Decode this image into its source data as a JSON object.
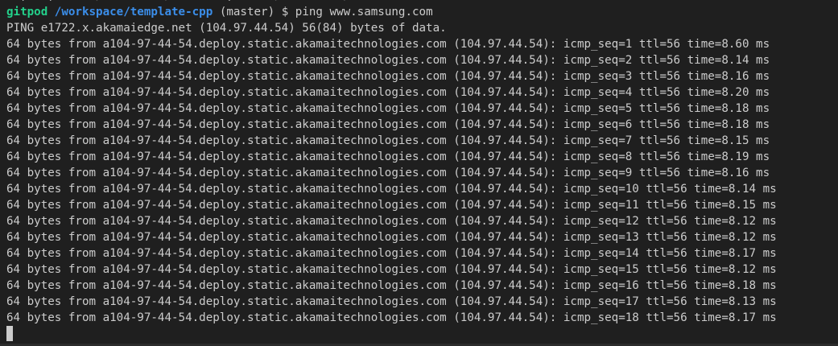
{
  "terminal": {
    "cut_line": "  ,   ,      /         /        ,      /         /",
    "prompt": {
      "user": "gitpod",
      "path": "/workspace/template-cpp",
      "branch": "(master)",
      "symbol": "$",
      "command": "ping www.samsung.com"
    },
    "header": "PING e1722.x.akamaiedge.net (104.97.44.54) 56(84) bytes of data.",
    "replies": [
      "64 bytes from a104-97-44-54.deploy.static.akamaitechnologies.com (104.97.44.54): icmp_seq=1 ttl=56 time=8.60 ms",
      "64 bytes from a104-97-44-54.deploy.static.akamaitechnologies.com (104.97.44.54): icmp_seq=2 ttl=56 time=8.14 ms",
      "64 bytes from a104-97-44-54.deploy.static.akamaitechnologies.com (104.97.44.54): icmp_seq=3 ttl=56 time=8.16 ms",
      "64 bytes from a104-97-44-54.deploy.static.akamaitechnologies.com (104.97.44.54): icmp_seq=4 ttl=56 time=8.20 ms",
      "64 bytes from a104-97-44-54.deploy.static.akamaitechnologies.com (104.97.44.54): icmp_seq=5 ttl=56 time=8.18 ms",
      "64 bytes from a104-97-44-54.deploy.static.akamaitechnologies.com (104.97.44.54): icmp_seq=6 ttl=56 time=8.18 ms",
      "64 bytes from a104-97-44-54.deploy.static.akamaitechnologies.com (104.97.44.54): icmp_seq=7 ttl=56 time=8.15 ms",
      "64 bytes from a104-97-44-54.deploy.static.akamaitechnologies.com (104.97.44.54): icmp_seq=8 ttl=56 time=8.19 ms",
      "64 bytes from a104-97-44-54.deploy.static.akamaitechnologies.com (104.97.44.54): icmp_seq=9 ttl=56 time=8.16 ms",
      "64 bytes from a104-97-44-54.deploy.static.akamaitechnologies.com (104.97.44.54): icmp_seq=10 ttl=56 time=8.14 ms",
      "64 bytes from a104-97-44-54.deploy.static.akamaitechnologies.com (104.97.44.54): icmp_seq=11 ttl=56 time=8.15 ms",
      "64 bytes from a104-97-44-54.deploy.static.akamaitechnologies.com (104.97.44.54): icmp_seq=12 ttl=56 time=8.12 ms",
      "64 bytes from a104-97-44-54.deploy.static.akamaitechnologies.com (104.97.44.54): icmp_seq=13 ttl=56 time=8.12 ms",
      "64 bytes from a104-97-44-54.deploy.static.akamaitechnologies.com (104.97.44.54): icmp_seq=14 ttl=56 time=8.17 ms",
      "64 bytes from a104-97-44-54.deploy.static.akamaitechnologies.com (104.97.44.54): icmp_seq=15 ttl=56 time=8.12 ms",
      "64 bytes from a104-97-44-54.deploy.static.akamaitechnologies.com (104.97.44.54): icmp_seq=16 ttl=56 time=8.18 ms",
      "64 bytes from a104-97-44-54.deploy.static.akamaitechnologies.com (104.97.44.54): icmp_seq=17 ttl=56 time=8.13 ms",
      "64 bytes from a104-97-44-54.deploy.static.akamaitechnologies.com (104.97.44.54): icmp_seq=18 ttl=56 time=8.17 ms"
    ],
    "colors": {
      "background": "#1f1f1f",
      "text": "#cccccc",
      "prompt_user": "#23d18b",
      "prompt_path": "#3b8eea"
    }
  }
}
